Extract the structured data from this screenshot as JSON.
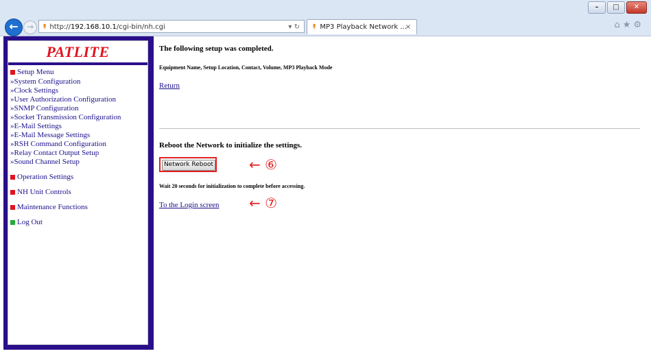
{
  "browser": {
    "address": {
      "prefix": "http://",
      "domain": "192.168.10.1",
      "path": "/cgi-bin/nh.cgi",
      "controls": "▾ ↻"
    },
    "tab": {
      "label": "MP3 Playback Network ...",
      "close": "×"
    },
    "tools": "⌂★⚙",
    "window": {
      "minimize": "–",
      "maximize": "□",
      "close": "✕"
    },
    "nav": {
      "back": "←",
      "forward": "→"
    }
  },
  "sidebar": {
    "logo": "PATLITE",
    "setup_menu": {
      "label": "Setup Menu",
      "items": [
        "»System Configuration",
        "»Clock Settings",
        "»User Authorization Configuration",
        "»SNMP Configuration",
        "»Socket Transmission Configuration",
        "»E-Mail Settings",
        "»E-Mail Message Settings",
        "»RSH Command Configuration",
        "»Relay Contact Output Setup",
        "»Sound Channel Setup"
      ]
    },
    "sections": [
      "Operation Settings",
      "NH Unit Controls",
      "Maintenance Functions",
      "Log Out"
    ],
    "colors": {
      "frame": "#2a0f8a",
      "logo": "#e0141e",
      "bullet": "#e0141e",
      "logout_bullet": "#22aa3a"
    }
  },
  "main": {
    "completed_title": "The following setup was completed.",
    "equipment_line": "Equipment Name, Setup Location, Contact, Volume, MP3 Playback Mode",
    "return_link": "Return",
    "reboot_title": "Reboot the Network to initialize the settings.",
    "reboot_button": "Network Reboot",
    "annotation_6": "← ⑥",
    "wait_text": "Wait 20 seconds for initialization to complete before accessing.",
    "login_link": "To the Login screen",
    "annotation_7": "← ⑦"
  }
}
